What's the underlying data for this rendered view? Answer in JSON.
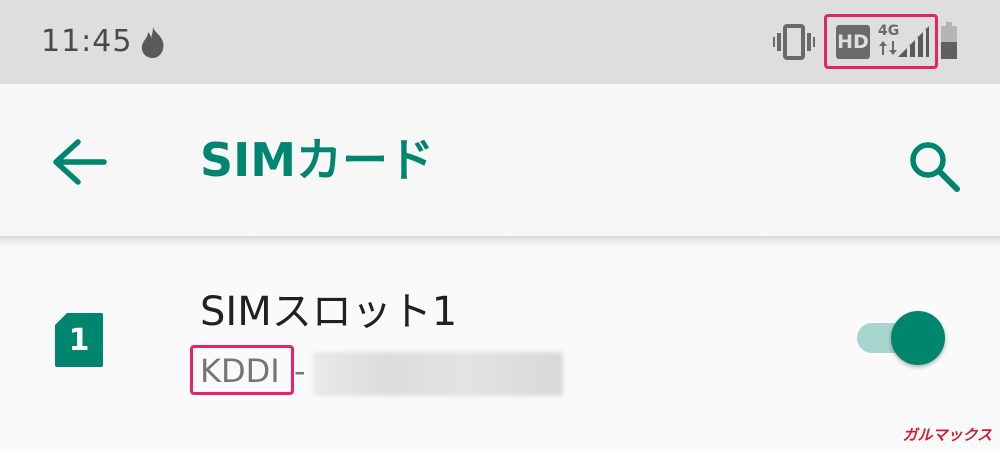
{
  "status_bar": {
    "time": "11:45",
    "hd_badge": "HD",
    "network_type": "4G",
    "icons": [
      "flame-icon",
      "vibrate-icon",
      "data-arrows-icon",
      "signal-icon",
      "battery-icon"
    ]
  },
  "app_bar": {
    "title": "SIMカード",
    "back_icon": "arrow-left-icon",
    "search_icon": "search-icon"
  },
  "sim_slot": {
    "slot_number": "1",
    "title": "SIMスロット1",
    "carrier": "KDDI",
    "separator": "-",
    "enabled": true
  },
  "watermark": "ガルマックス",
  "colors": {
    "accent": "#00856f",
    "highlight": "#e5236b",
    "status_bar_bg": "#dedede",
    "toggle_track": "#a6d6cd"
  }
}
